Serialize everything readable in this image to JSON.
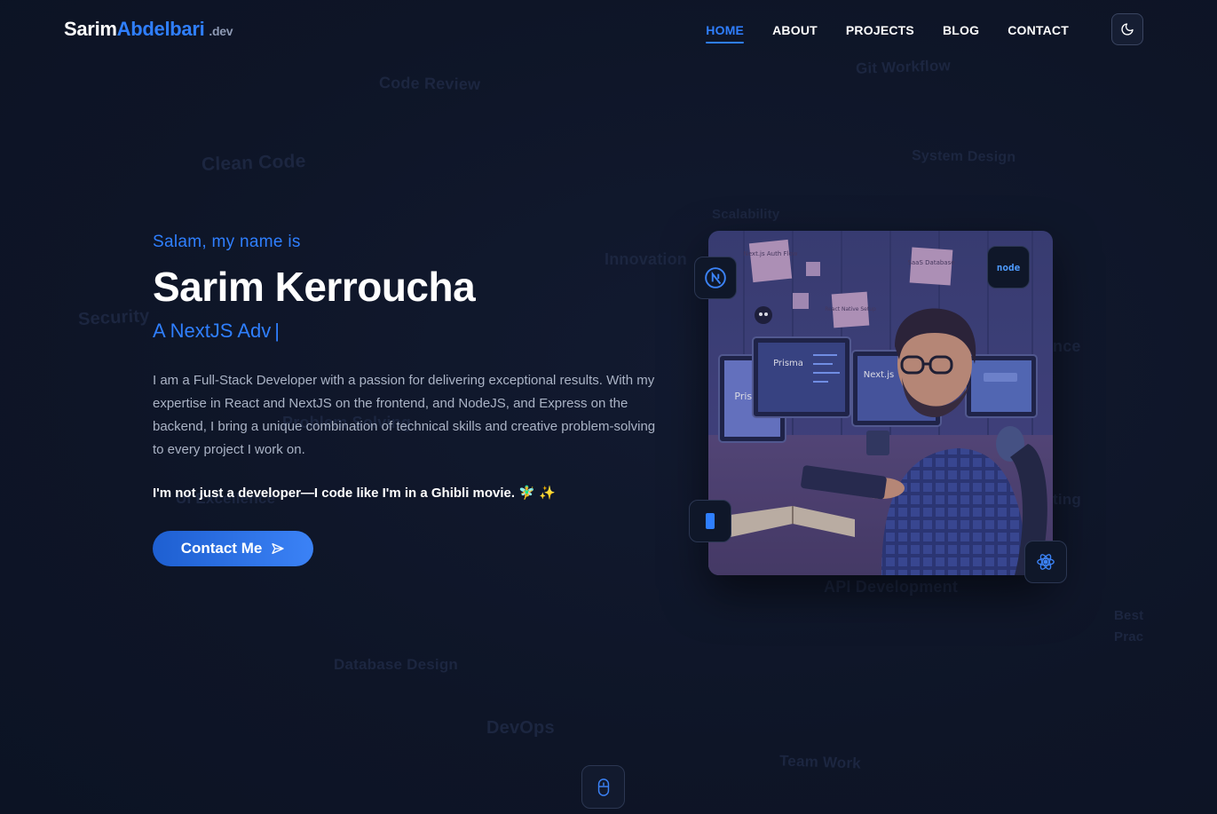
{
  "brand": {
    "first": "Sarim",
    "second": "Abdelbari",
    "suffix": ".dev"
  },
  "nav": {
    "items": [
      {
        "label": "HOME",
        "active": true
      },
      {
        "label": "ABOUT"
      },
      {
        "label": "PROJECTS"
      },
      {
        "label": "BLOG"
      },
      {
        "label": "CONTACT"
      }
    ]
  },
  "hero": {
    "greeting": "Salam, my name is",
    "name": "Sarim Kerroucha",
    "typed_text": "A NextJS Adv",
    "typed_cursor": "|",
    "bio": "I am a Full-Stack Developer with a passion for delivering exceptional results. With my expertise in React and NextJS on the frontend, and NodeJS, and Express on the backend, I bring a unique combination of technical skills and creative problem-solving to every project I work on.",
    "tagline": "I'm not just a developer—I code like I'm in a Ghibli movie. 🧚‍♂️ ✨",
    "cta_label": "Contact Me"
  },
  "background_words": [
    "Code Review",
    "Git Workflow",
    "Clean Code",
    "System Design",
    "Scalability",
    "Innovation",
    "Security",
    "nce",
    "Problem Solving",
    "UI Excellence",
    "ting",
    "API Development",
    "Best",
    "Prac",
    "Database Design",
    "DevOps",
    "Team Work"
  ],
  "illustration": {
    "notes": [
      "Next.js Auth Flow",
      "SaaS Database",
      "React Native Setup"
    ],
    "screens": [
      "Prisma",
      "Prisma",
      "Next.js"
    ],
    "node_badge": "node"
  },
  "colors": {
    "background": "#0e1527",
    "accent": "#2f7fff",
    "text": "#ffffff",
    "muted": "#aab3c5"
  },
  "icons": {
    "theme": "moon-icon",
    "cta": "send-icon",
    "scroll": "mouse-icon"
  }
}
